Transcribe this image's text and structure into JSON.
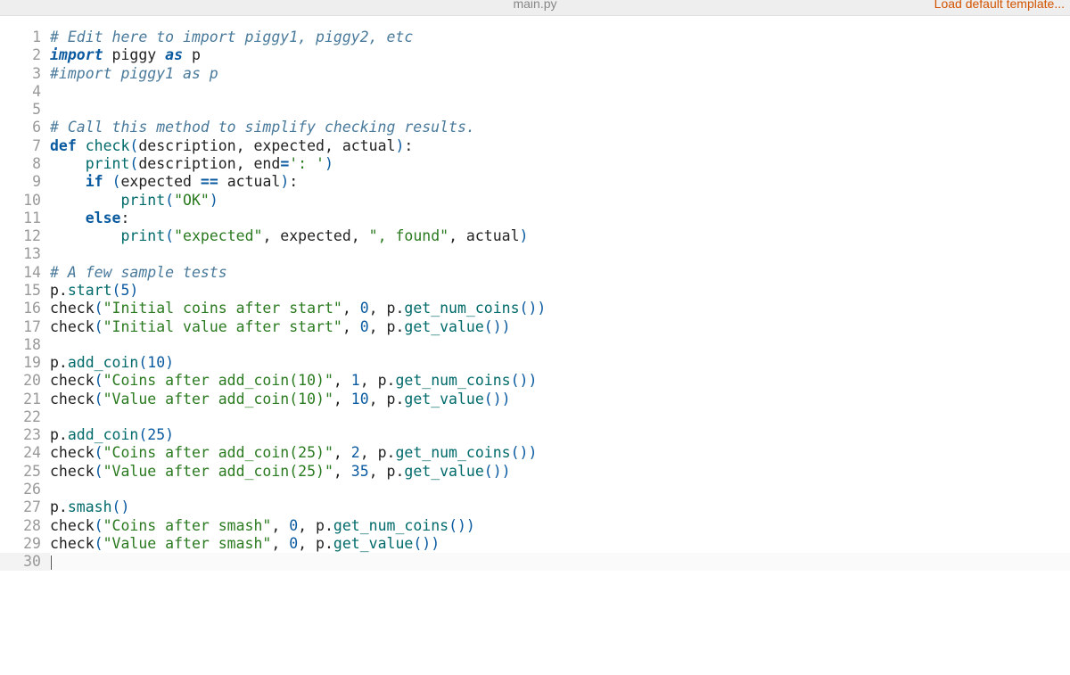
{
  "header": {
    "filename": "main.py",
    "load_template_label": "Load default template..."
  },
  "editor": {
    "current_line": 30,
    "lines": [
      {
        "n": 1,
        "tokens": [
          [
            "comment",
            "# Edit here to import piggy1, piggy2, etc"
          ]
        ]
      },
      {
        "n": 2,
        "tokens": [
          [
            "kw-i",
            "import"
          ],
          [
            "sp",
            " "
          ],
          [
            "default",
            "piggy"
          ],
          [
            "sp",
            " "
          ],
          [
            "kw-i",
            "as"
          ],
          [
            "sp",
            " "
          ],
          [
            "default",
            "p"
          ]
        ]
      },
      {
        "n": 3,
        "tokens": [
          [
            "comment",
            "#import piggy1 as p"
          ]
        ]
      },
      {
        "n": 4,
        "tokens": []
      },
      {
        "n": 5,
        "tokens": []
      },
      {
        "n": 6,
        "tokens": [
          [
            "comment",
            "# Call this method to simplify checking results."
          ]
        ]
      },
      {
        "n": 7,
        "tokens": [
          [
            "kw",
            "def"
          ],
          [
            "sp",
            " "
          ],
          [
            "func",
            "check"
          ],
          [
            "paren",
            "("
          ],
          [
            "default",
            "description"
          ],
          [
            "default",
            ", expected, actual"
          ],
          [
            "paren",
            ")"
          ],
          [
            "default",
            ":"
          ]
        ]
      },
      {
        "n": 8,
        "tokens": [
          [
            "sp",
            "    "
          ],
          [
            "func",
            "print"
          ],
          [
            "paren",
            "("
          ],
          [
            "default",
            "description, end"
          ],
          [
            "op",
            "="
          ],
          [
            "str",
            "': '"
          ],
          [
            "paren",
            ")"
          ]
        ]
      },
      {
        "n": 9,
        "tokens": [
          [
            "sp",
            "    "
          ],
          [
            "kw",
            "if"
          ],
          [
            "sp",
            " "
          ],
          [
            "paren",
            "("
          ],
          [
            "default",
            "expected "
          ],
          [
            "op",
            "=="
          ],
          [
            "default",
            " actual"
          ],
          [
            "paren",
            ")"
          ],
          [
            "default",
            ":"
          ]
        ]
      },
      {
        "n": 10,
        "tokens": [
          [
            "sp",
            "        "
          ],
          [
            "func",
            "print"
          ],
          [
            "paren",
            "("
          ],
          [
            "str",
            "\"OK\""
          ],
          [
            "paren",
            ")"
          ]
        ]
      },
      {
        "n": 11,
        "tokens": [
          [
            "sp",
            "    "
          ],
          [
            "kw",
            "else"
          ],
          [
            "default",
            ":"
          ]
        ]
      },
      {
        "n": 12,
        "tokens": [
          [
            "sp",
            "        "
          ],
          [
            "func",
            "print"
          ],
          [
            "paren",
            "("
          ],
          [
            "str",
            "\"expected\""
          ],
          [
            "default",
            ", expected, "
          ],
          [
            "str",
            "\", found\""
          ],
          [
            "default",
            ", actual"
          ],
          [
            "paren",
            ")"
          ]
        ]
      },
      {
        "n": 13,
        "tokens": []
      },
      {
        "n": 14,
        "tokens": [
          [
            "comment",
            "# A few sample tests"
          ]
        ]
      },
      {
        "n": 15,
        "tokens": [
          [
            "default",
            "p."
          ],
          [
            "func",
            "start"
          ],
          [
            "paren",
            "("
          ],
          [
            "num",
            "5"
          ],
          [
            "paren",
            ")"
          ]
        ]
      },
      {
        "n": 16,
        "tokens": [
          [
            "default",
            "check"
          ],
          [
            "paren",
            "("
          ],
          [
            "str",
            "\"Initial coins after start\""
          ],
          [
            "default",
            ", "
          ],
          [
            "num",
            "0"
          ],
          [
            "default",
            ", p."
          ],
          [
            "func",
            "get_num_coins"
          ],
          [
            "paren",
            "())"
          ]
        ]
      },
      {
        "n": 17,
        "tokens": [
          [
            "default",
            "check"
          ],
          [
            "paren",
            "("
          ],
          [
            "str",
            "\"Initial value after start\""
          ],
          [
            "default",
            ", "
          ],
          [
            "num",
            "0"
          ],
          [
            "default",
            ", p."
          ],
          [
            "func",
            "get_value"
          ],
          [
            "paren",
            "())"
          ]
        ]
      },
      {
        "n": 18,
        "tokens": []
      },
      {
        "n": 19,
        "tokens": [
          [
            "default",
            "p."
          ],
          [
            "func",
            "add_coin"
          ],
          [
            "paren",
            "("
          ],
          [
            "num",
            "10"
          ],
          [
            "paren",
            ")"
          ]
        ]
      },
      {
        "n": 20,
        "tokens": [
          [
            "default",
            "check"
          ],
          [
            "paren",
            "("
          ],
          [
            "str",
            "\"Coins after add_coin(10)\""
          ],
          [
            "default",
            ", "
          ],
          [
            "num",
            "1"
          ],
          [
            "default",
            ", p."
          ],
          [
            "func",
            "get_num_coins"
          ],
          [
            "paren",
            "())"
          ]
        ]
      },
      {
        "n": 21,
        "tokens": [
          [
            "default",
            "check"
          ],
          [
            "paren",
            "("
          ],
          [
            "str",
            "\"Value after add_coin(10)\""
          ],
          [
            "default",
            ", "
          ],
          [
            "num",
            "10"
          ],
          [
            "default",
            ", p."
          ],
          [
            "func",
            "get_value"
          ],
          [
            "paren",
            "())"
          ]
        ]
      },
      {
        "n": 22,
        "tokens": []
      },
      {
        "n": 23,
        "tokens": [
          [
            "default",
            "p."
          ],
          [
            "func",
            "add_coin"
          ],
          [
            "paren",
            "("
          ],
          [
            "num",
            "25"
          ],
          [
            "paren",
            ")"
          ]
        ]
      },
      {
        "n": 24,
        "tokens": [
          [
            "default",
            "check"
          ],
          [
            "paren",
            "("
          ],
          [
            "str",
            "\"Coins after add_coin(25)\""
          ],
          [
            "default",
            ", "
          ],
          [
            "num",
            "2"
          ],
          [
            "default",
            ", p."
          ],
          [
            "func",
            "get_num_coins"
          ],
          [
            "paren",
            "())"
          ]
        ]
      },
      {
        "n": 25,
        "tokens": [
          [
            "default",
            "check"
          ],
          [
            "paren",
            "("
          ],
          [
            "str",
            "\"Value after add_coin(25)\""
          ],
          [
            "default",
            ", "
          ],
          [
            "num",
            "35"
          ],
          [
            "default",
            ", p."
          ],
          [
            "func",
            "get_value"
          ],
          [
            "paren",
            "())"
          ]
        ]
      },
      {
        "n": 26,
        "tokens": []
      },
      {
        "n": 27,
        "tokens": [
          [
            "default",
            "p."
          ],
          [
            "func",
            "smash"
          ],
          [
            "paren",
            "()"
          ]
        ]
      },
      {
        "n": 28,
        "tokens": [
          [
            "default",
            "check"
          ],
          [
            "paren",
            "("
          ],
          [
            "str",
            "\"Coins after smash\""
          ],
          [
            "default",
            ", "
          ],
          [
            "num",
            "0"
          ],
          [
            "default",
            ", p."
          ],
          [
            "func",
            "get_num_coins"
          ],
          [
            "paren",
            "())"
          ]
        ]
      },
      {
        "n": 29,
        "tokens": [
          [
            "default",
            "check"
          ],
          [
            "paren",
            "("
          ],
          [
            "str",
            "\"Value after smash\""
          ],
          [
            "default",
            ", "
          ],
          [
            "num",
            "0"
          ],
          [
            "default",
            ", p."
          ],
          [
            "func",
            "get_value"
          ],
          [
            "paren",
            "())"
          ]
        ]
      },
      {
        "n": 30,
        "tokens": []
      }
    ]
  }
}
